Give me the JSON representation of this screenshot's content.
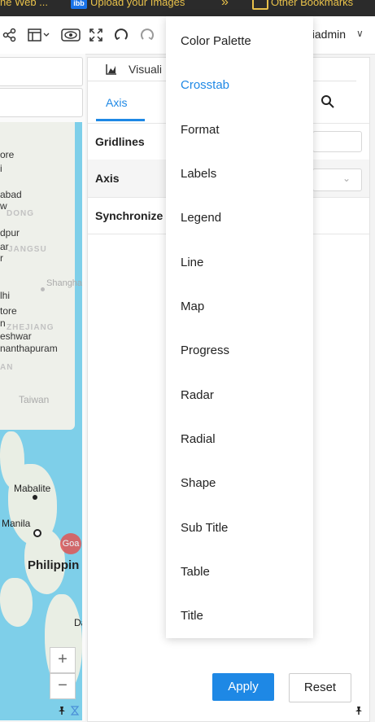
{
  "bookmarks": [
    {
      "label": "he Web ..."
    },
    {
      "label": "Upload your Images",
      "icon": "imgbb-logo"
    },
    {
      "label": "Other Bookmarks",
      "icon": "folder-icon"
    }
  ],
  "toolbar": {
    "icons": [
      "share-icon",
      "layout-icon",
      "preview-icon",
      "fullscreen-icon",
      "undo-icon",
      "redo-icon"
    ],
    "user_name": "niadmin",
    "user_caret": "∨"
  },
  "map": {
    "cities": [
      "ore",
      "i",
      "abad",
      "w",
      "DONG",
      "dpur",
      "ar",
      "r",
      "JANGSU",
      "Shanghai",
      "lhi",
      "tore",
      "n",
      "ZHEJIANG",
      "eshwar",
      "nanthapuram",
      "AN",
      "Taiwan",
      "Mabalite",
      "Manila",
      "Philippin",
      "Goa",
      "Da"
    ],
    "zoom_in": "+",
    "zoom_out": "−",
    "marker_color": "#e05555",
    "water_color": "#7ecfe9"
  },
  "panel": {
    "title": "Visuali",
    "active_tab": "Axis",
    "sections": [
      "Gridlines",
      "Axis",
      "Synchronize"
    ],
    "apply_label": "Apply",
    "reset_label": "Reset",
    "accent": "#1e88e5"
  },
  "menu": {
    "items": [
      "Color Palette",
      "Crosstab",
      "Format",
      "Labels",
      "Legend",
      "Line",
      "Map",
      "Progress",
      "Radar",
      "Radial",
      "Shape",
      "Sub Title",
      "Table",
      "Title"
    ],
    "active_item": "Crosstab"
  }
}
